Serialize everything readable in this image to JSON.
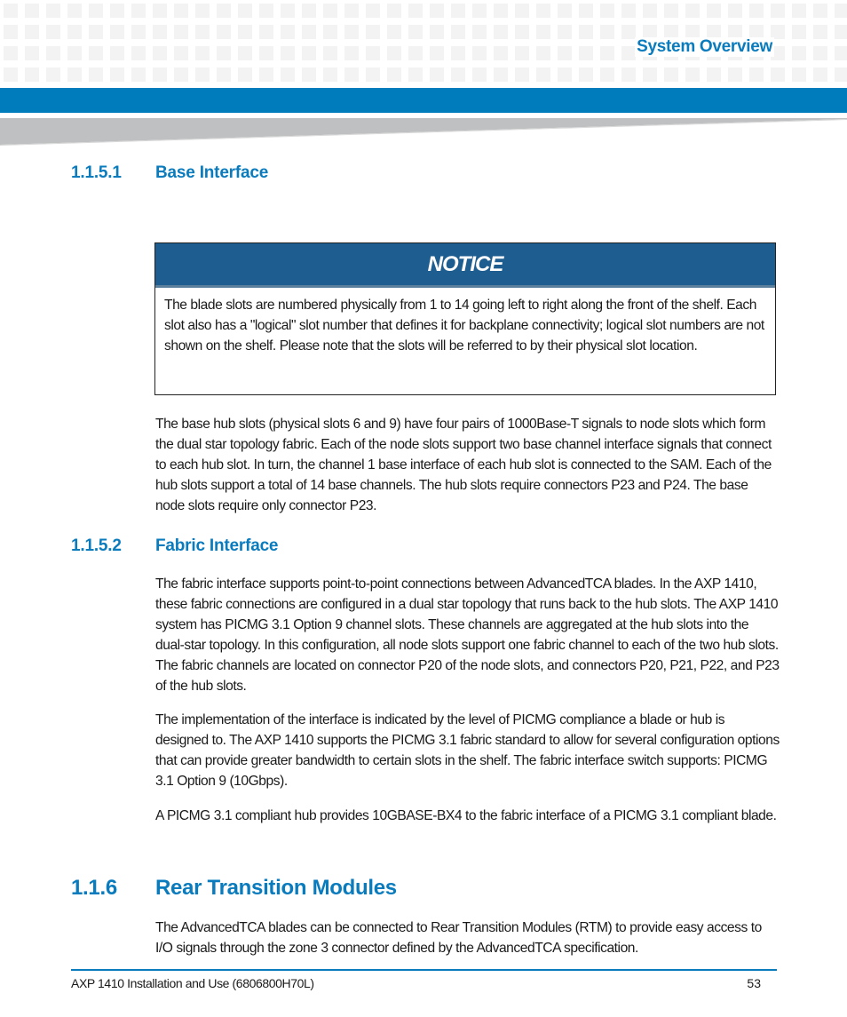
{
  "header": {
    "running_title": "System Overview"
  },
  "sections": {
    "base_interface": {
      "number": "1.1.5.1",
      "title": "Base Interface",
      "notice": {
        "title": "NOTICE",
        "text": "The blade slots are numbered physically from 1 to 14 going left to right along the front of the shelf. Each slot also has a \"logical\" slot number that defines it for backplane connectivity; logical slot numbers are not shown on the shelf. Please note that the slots will be referred to by their physical slot location."
      },
      "paragraphs": [
        "The base hub slots (physical slots 6 and 9) have four pairs of 1000Base-T signals to node slots which form the dual star topology fabric. Each of the node slots support two base channel interface signals that connect to each hub slot. In turn, the channel 1 base interface of each hub slot is connected to the SAM. Each of the hub slots support a total of 14 base channels. The hub slots require connectors P23 and P24. The base node slots require only connector P23."
      ]
    },
    "fabric_interface": {
      "number": "1.1.5.2",
      "title": "Fabric Interface",
      "paragraphs": [
        "The fabric interface supports point-to-point connections between AdvancedTCA blades. In the AXP 1410, these fabric connections are configured in a dual star topology that runs back to the hub slots. The AXP 1410 system has PICMG 3.1 Option 9 channel slots. These channels are aggregated at the hub slots into the dual-star topology. In this configuration, all node slots support one fabric channel to each of the two hub slots. The fabric channels are located on connector P20 of the node slots, and connectors P20, P21, P22, and P23 of the hub slots.",
        "The implementation of the interface is indicated by the level of PICMG compliance a blade or hub is designed to. The AXP 1410 supports the PICMG 3.1 fabric standard to allow for several configuration options that can provide greater bandwidth to certain slots in the shelf. The fabric interface switch supports: PICMG 3.1 Option 9 (10Gbps).",
        "A PICMG 3.1 compliant hub provides 10GBASE-BX4 to the fabric interface of a PICMG 3.1 compliant blade."
      ]
    },
    "rtm": {
      "number": "1.1.6",
      "title": "Rear Transition Modules",
      "paragraphs": [
        "The AdvancedTCA blades can be connected to Rear Transition Modules (RTM) to provide easy access to I/O signals through the zone 3 connector defined by the AdvancedTCA specification."
      ]
    }
  },
  "footer": {
    "document_title": "AXP 1410 Installation and Use (6806800H70L)",
    "page_number": "53"
  },
  "colors": {
    "brand_blue": "#007cbd",
    "heading_blue": "#0a7bbd",
    "notice_blue": "#1d5d8f"
  }
}
